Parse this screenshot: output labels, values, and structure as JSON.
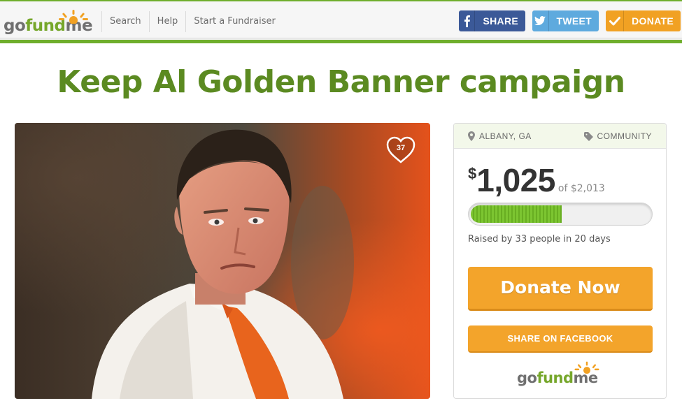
{
  "header": {
    "logo": {
      "go": "go",
      "fund": "fund",
      "me": "me"
    },
    "nav": [
      "Search",
      "Help",
      "Start a Fundraiser"
    ],
    "share_buttons": [
      {
        "label": "SHARE",
        "icon": "facebook-icon",
        "color": "#3b5998"
      },
      {
        "label": "TWEET",
        "icon": "twitter-icon",
        "color": "#5eaade"
      },
      {
        "label": "DONATE",
        "icon": "checkmark-icon",
        "color": "#f1a123"
      }
    ]
  },
  "campaign": {
    "title": "Keep Al Golden Banner campaign",
    "hearts": "37",
    "location": "ALBANY, GA",
    "category": "COMMUNITY",
    "raised": {
      "currency": "$",
      "amount": "1,025",
      "goal": "of $2,013",
      "progress": 0.509
    },
    "raised_text": "Raised by 33 people in 20 days",
    "donate_label": "Donate Now",
    "share_label": "SHARE ON FACEBOOK"
  },
  "colors": {
    "brand_green": "#6fae2c",
    "title_green": "#5b8a21",
    "orange": "#f3a42b"
  }
}
